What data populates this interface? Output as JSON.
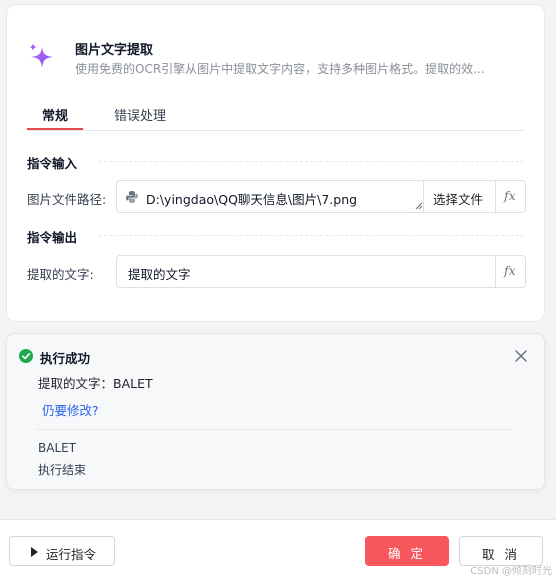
{
  "header": {
    "title": "图片文字提取",
    "description": "使用免费的OCR引擎从图片中提取文字内容，支持多种图片格式。提取的效..."
  },
  "tabs": [
    {
      "label": "常规",
      "active": true
    },
    {
      "label": "错误处理",
      "active": false
    }
  ],
  "input_section": {
    "title": "指令输入",
    "image_path_label": "图片文件路径:",
    "image_path_value": "D:\\yingdao\\QQ聊天信息\\图片\\7.png",
    "choose_file_label": "选择文件",
    "fx_label": "fx"
  },
  "output_section": {
    "title": "指令输出",
    "text_label": "提取的文字:",
    "text_value": "提取的文字",
    "fx_label": "fx"
  },
  "result": {
    "title": "执行成功",
    "line1": "提取的文字：BALET",
    "link": "仍要修改?",
    "log1": "BALET",
    "log2": "执行结束"
  },
  "footer": {
    "run_label": "运行指令",
    "ok_label": "确 定",
    "cancel_label": "取 消"
  },
  "watermark": "CSDN @倾刻时光",
  "colors": {
    "accent": "#e5484d",
    "primary_button": "#f7575c",
    "success": "#22a854",
    "link": "#2563eb",
    "sparkle": "#9b5cf6"
  }
}
